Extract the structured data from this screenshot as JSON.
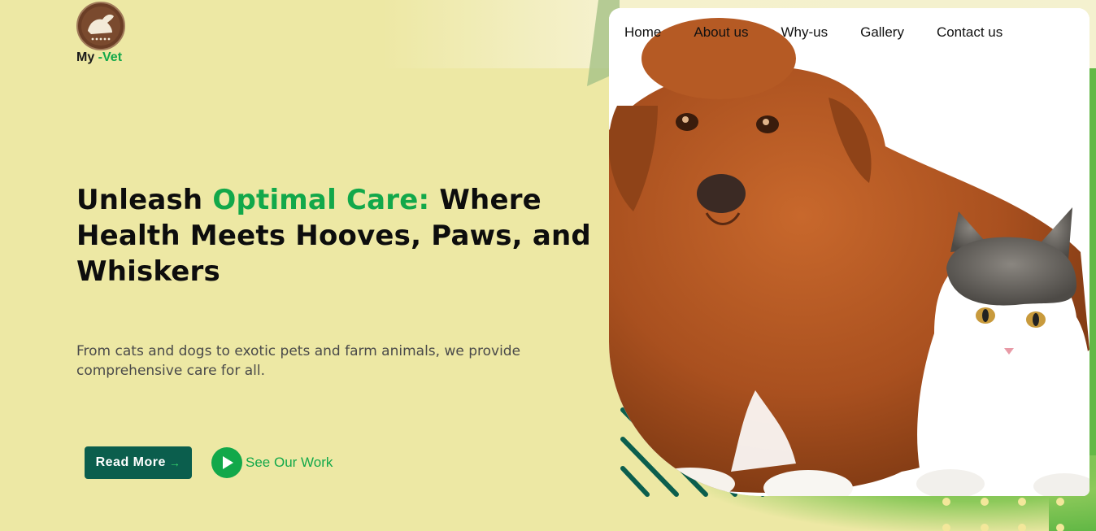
{
  "brand": {
    "name_part1": "My",
    "name_part2": " -Vet",
    "logo_icon": "pets-logo-icon",
    "accent_color": "#12a84a"
  },
  "nav": {
    "items": [
      {
        "label": "Home"
      },
      {
        "label": "About us"
      },
      {
        "label": "Why-us"
      },
      {
        "label": "Gallery"
      },
      {
        "label": "Contact us"
      }
    ]
  },
  "hero": {
    "headline_part1": "Unleash ",
    "headline_accent": "Optimal Care:",
    "headline_part2": " Where Health Meets Hooves, Paws, and Whiskers",
    "subtext": "From cats and dogs to exotic pets and farm animals, we provide comprehensive care for all.",
    "read_more_label": "Read More",
    "read_more_arrow": "→",
    "see_work_label": "See Our Work",
    "play_icon": "play-icon"
  },
  "image": {
    "subject": "dog-and-cat-photo"
  },
  "colors": {
    "background": "#ede8a4",
    "primary_dark": "#0b5e4d",
    "accent_green": "#12a84a",
    "side_green": "#63b846"
  }
}
